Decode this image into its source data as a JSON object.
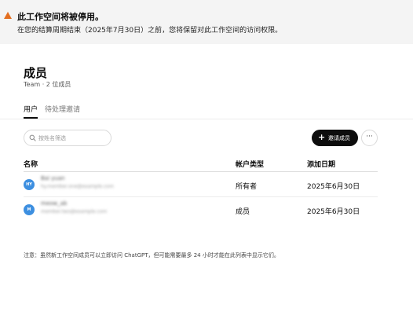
{
  "banner": {
    "icon": "warning-triangle-icon",
    "accent": "#e36f21",
    "title": "此工作空间将被停用。",
    "message": "在您的结算周期结束（2025年7月30日）之前，您将保留对此工作空间的访问权限。"
  },
  "page": {
    "title": "成员",
    "subtitle": "Team · 2 位成员"
  },
  "tabs": [
    {
      "label": "用户",
      "active": true
    },
    {
      "label": "待处理邀请",
      "active": false
    }
  ],
  "search": {
    "placeholder": "按姓名筛选",
    "value": "",
    "icon": "search-icon"
  },
  "toolbar": {
    "invite_label": "邀请成员",
    "invite_icon": "plus-icon",
    "more_icon": "more-horizontal-icon"
  },
  "table": {
    "columns": [
      "名称",
      "帐户类型",
      "添加日期"
    ],
    "rows": [
      {
        "avatar": "HY",
        "avatar_color": "#3d8fe0",
        "name": "Bai yuan",
        "email": "hy.member.one@example.com",
        "role": "所有者",
        "date": "2025年6月30日"
      },
      {
        "avatar": "M",
        "avatar_color": "#3d8fe0",
        "name": "meow_ab",
        "email": "member.two@example.com",
        "role": "成员",
        "date": "2025年6月30日"
      }
    ]
  },
  "note": "注意：虽然新工作空间成员可以立即访问 ChatGPT，但可能需要最多 24 小时才能在此列表中显示它们。"
}
